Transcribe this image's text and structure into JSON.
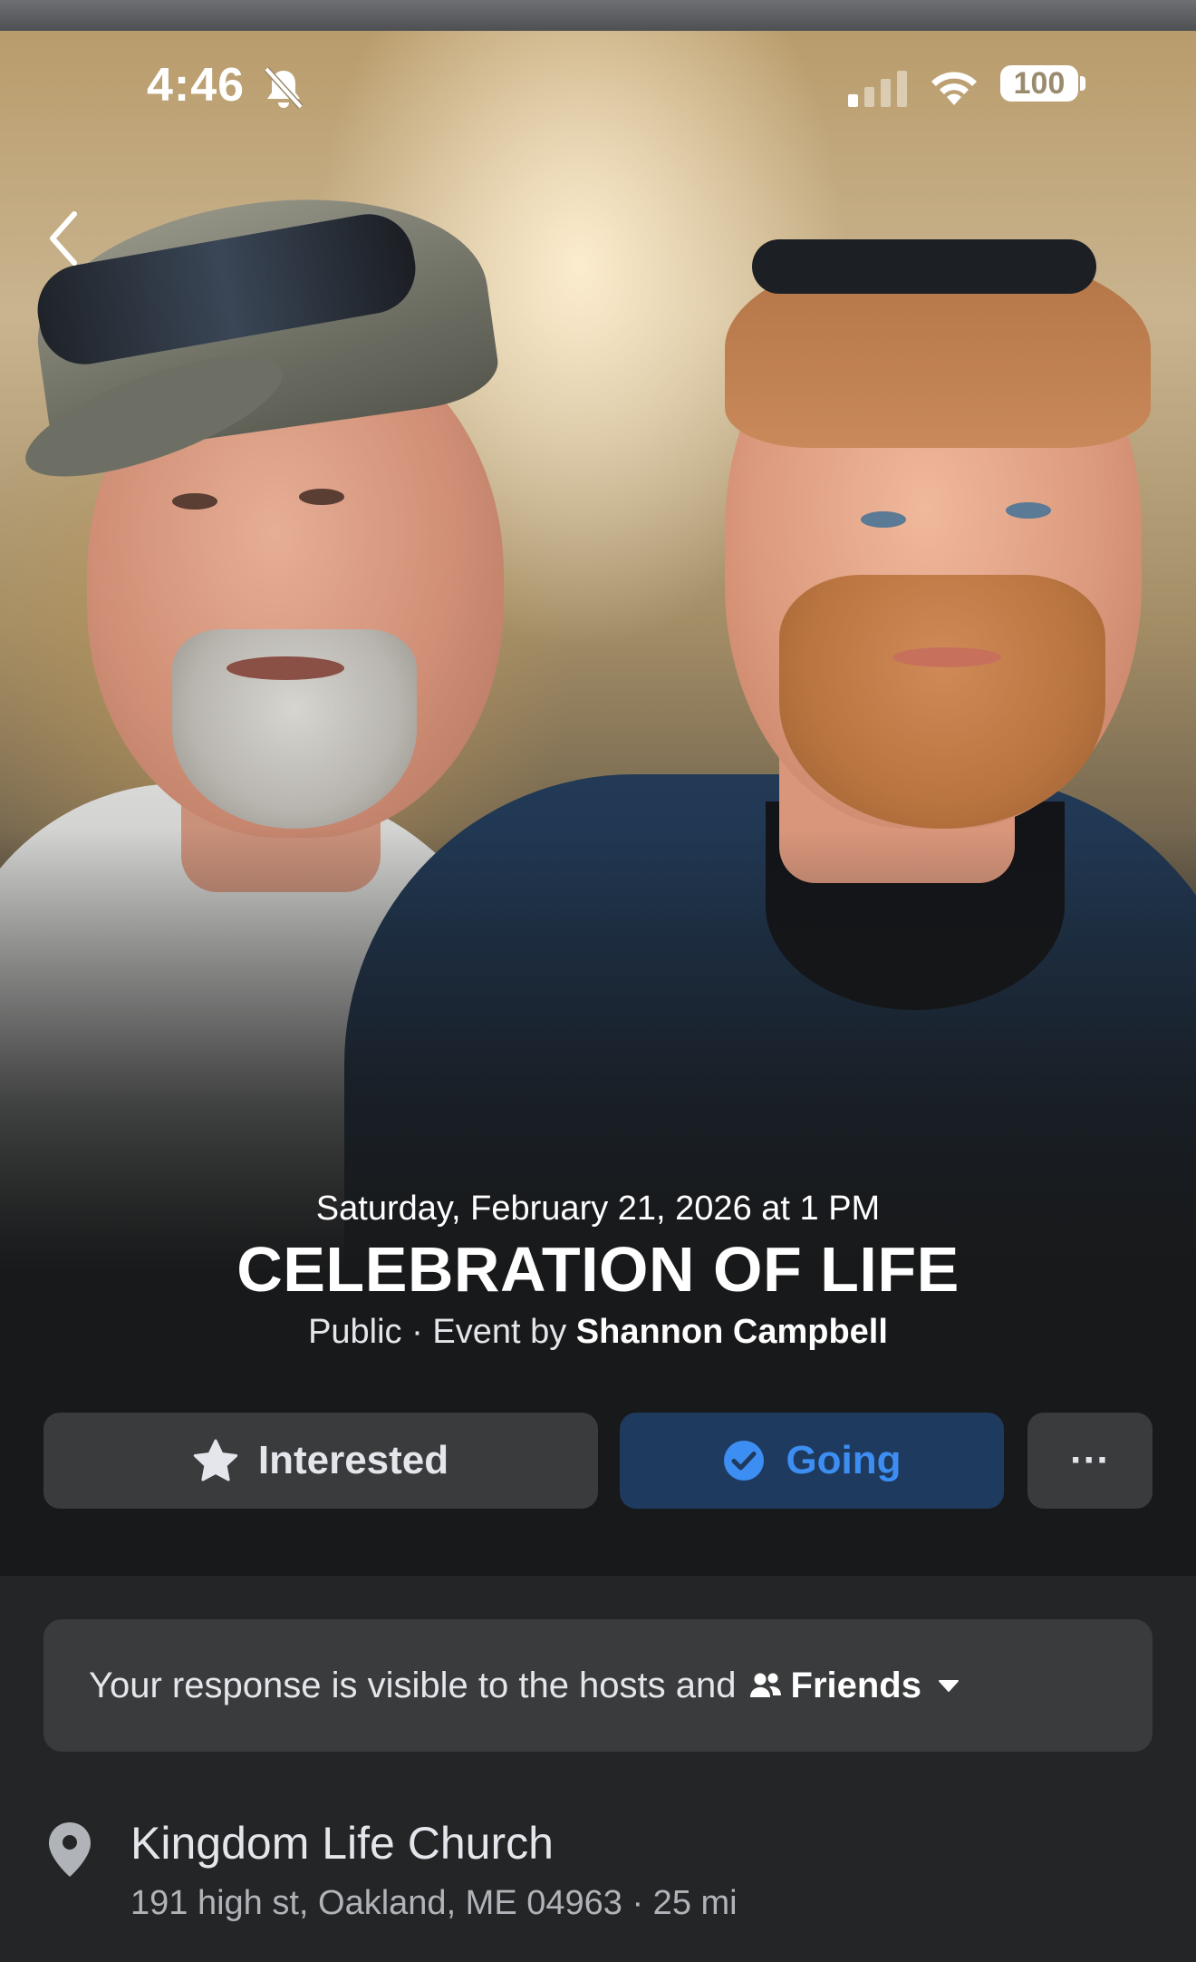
{
  "status_bar": {
    "time": "4:46",
    "battery": "100",
    "icons": [
      "bell-off-icon",
      "signal-icon",
      "wifi-icon",
      "battery-icon"
    ]
  },
  "hero": {
    "back_icon": "chevron-left-icon"
  },
  "event": {
    "date": "Saturday, February 21, 2026 at 1 PM",
    "title": "CELEBRATION OF LIFE",
    "privacy": "Public",
    "separator": " · ",
    "by_label": "Event by",
    "host": "Shannon Campbell"
  },
  "actions": {
    "interested_label": "Interested",
    "interested_icon": "star-icon",
    "going_label": "Going",
    "going_icon": "check-circle-icon",
    "more_label": "···",
    "going_color": "#3d8ef2"
  },
  "visibility": {
    "text": "Your response is visible to the hosts and",
    "audience": "Friends",
    "audience_icon": "people-icon",
    "caret_icon": "caret-down-icon"
  },
  "location": {
    "icon": "map-pin-icon",
    "name": "Kingdom Life Church",
    "address": "191 high st, Oakland, ME 04963 · 25 mi"
  }
}
